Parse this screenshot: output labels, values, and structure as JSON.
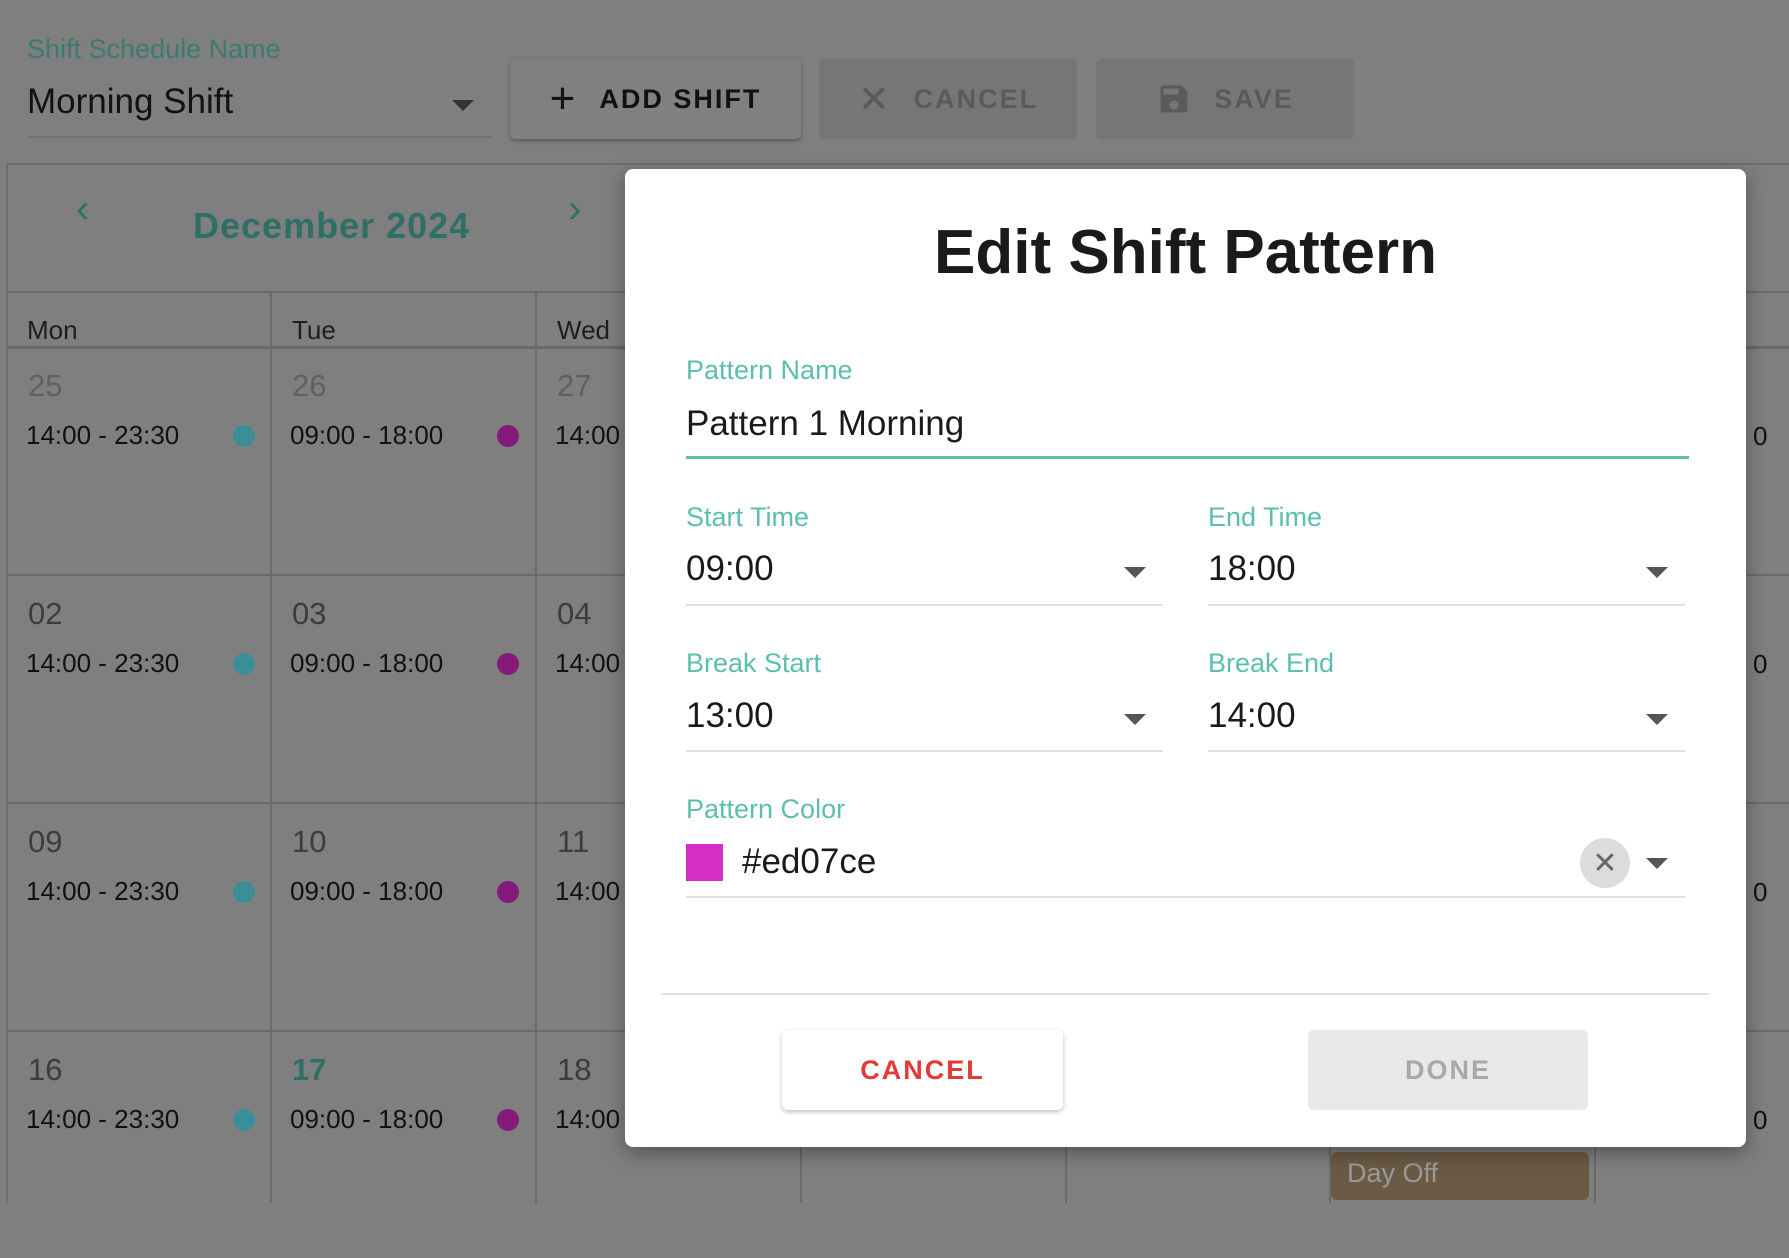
{
  "toolbar": {
    "schedule_label": "Shift Schedule Name",
    "schedule_value": "Morning Shift",
    "add_shift": "ADD SHIFT",
    "cancel": "CANCEL",
    "save": "SAVE"
  },
  "calendar": {
    "month": "December 2024",
    "days": [
      "Mon",
      "Tue",
      "Wed"
    ],
    "weeks": [
      [
        {
          "num": "25",
          "time": "14:00 - 23:30",
          "dot": "#3a8e98",
          "dim": true
        },
        {
          "num": "26",
          "time": "09:00 - 18:00",
          "dot": "#851a7a",
          "dim": true
        },
        {
          "num": "27",
          "time": "14:00",
          "dim": true
        }
      ],
      [
        {
          "num": "02",
          "time": "14:00 - 23:30",
          "dot": "#3a8e98"
        },
        {
          "num": "03",
          "time": "09:00 - 18:00",
          "dot": "#851a7a"
        },
        {
          "num": "04",
          "time": "14:00"
        }
      ],
      [
        {
          "num": "09",
          "time": "14:00 - 23:30",
          "dot": "#3a8e98"
        },
        {
          "num": "10",
          "time": "09:00 - 18:00",
          "dot": "#851a7a"
        },
        {
          "num": "11",
          "time": "14:00"
        }
      ],
      [
        {
          "num": "16",
          "time": "14:00 - 23:30",
          "dot": "#3a8e98"
        },
        {
          "num": "17",
          "time": "09:00 - 18:00",
          "dot": "#851a7a",
          "today": true
        },
        {
          "num": "18",
          "time": "14:00"
        }
      ]
    ],
    "right_edge_fragment": "0",
    "day_off_label": "Day Off"
  },
  "dialog": {
    "title": "Edit Shift Pattern",
    "pattern_name_label": "Pattern Name",
    "pattern_name_value": "Pattern 1 Morning",
    "start_time_label": "Start Time",
    "start_time_value": "09:00",
    "end_time_label": "End Time",
    "end_time_value": "18:00",
    "break_start_label": "Break Start",
    "break_start_value": "13:00",
    "break_end_label": "Break End",
    "break_end_value": "14:00",
    "pattern_color_label": "Pattern Color",
    "pattern_color_value": "#ed07ce",
    "cancel": "CANCEL",
    "done": "DONE"
  },
  "colors": {
    "accent": "#5bbfad",
    "danger": "#e53935",
    "swatch": "#d62fc8"
  }
}
